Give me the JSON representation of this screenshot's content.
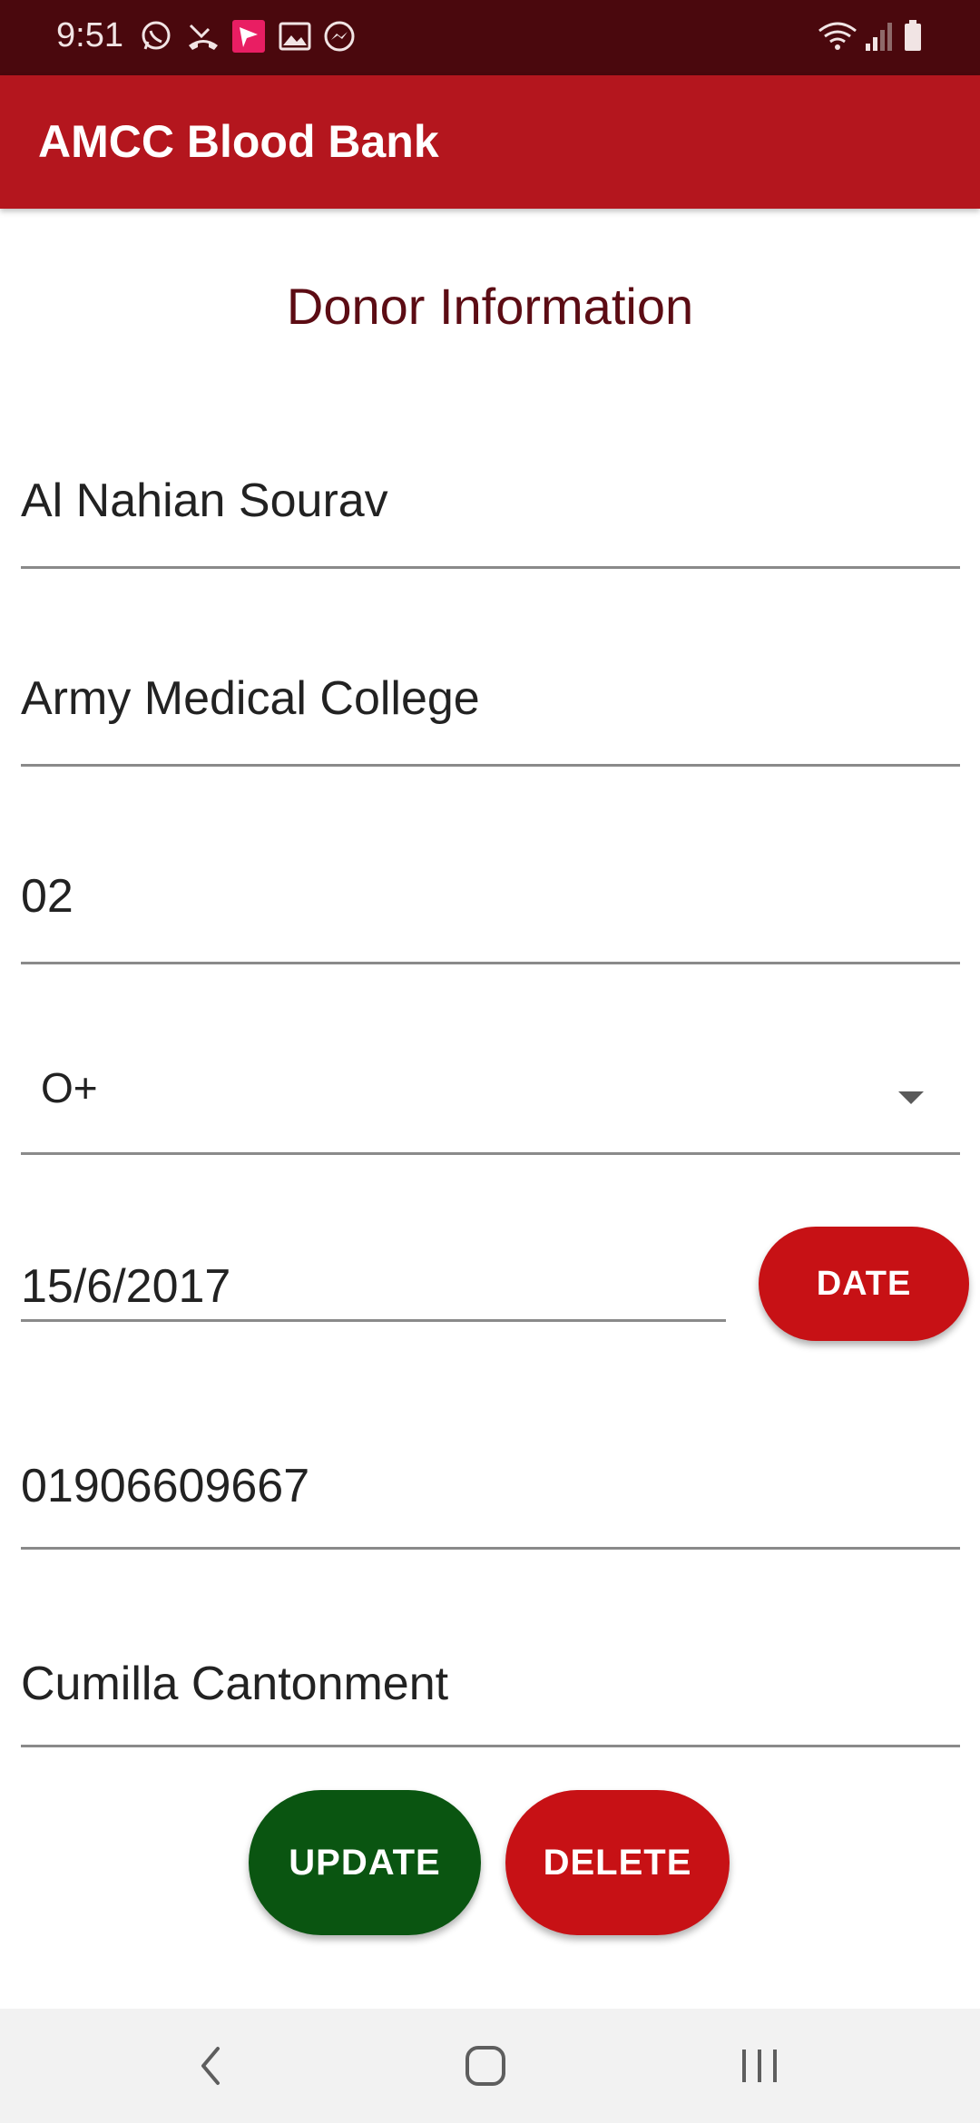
{
  "status_bar": {
    "time": "9:51",
    "icons": [
      "whatsapp-icon",
      "missed-call-icon",
      "app-notification-icon",
      "gallery-icon",
      "messenger-icon",
      "wifi-icon",
      "signal-icon",
      "battery-icon"
    ]
  },
  "app_bar": {
    "title": "AMCC Blood Bank"
  },
  "page": {
    "title": "Donor Information"
  },
  "form": {
    "name": "Al Nahian Sourav",
    "institution": "Army Medical College",
    "batch": "02",
    "blood_group": "O+",
    "last_donation_date": "15/6/2017",
    "phone": "01906609667",
    "address": "Cumilla Cantonment"
  },
  "buttons": {
    "date": "DATE",
    "update": "UPDATE",
    "delete": "DELETE"
  },
  "colors": {
    "status_bar": "#4a080d",
    "app_bar": "#b4161e",
    "title_text": "#5c0c14",
    "date_button": "#c71115",
    "update_button": "#0a5511",
    "delete_button": "#c71115"
  },
  "nav_bar": {
    "icons": [
      "back-icon",
      "home-icon",
      "recents-icon"
    ]
  }
}
